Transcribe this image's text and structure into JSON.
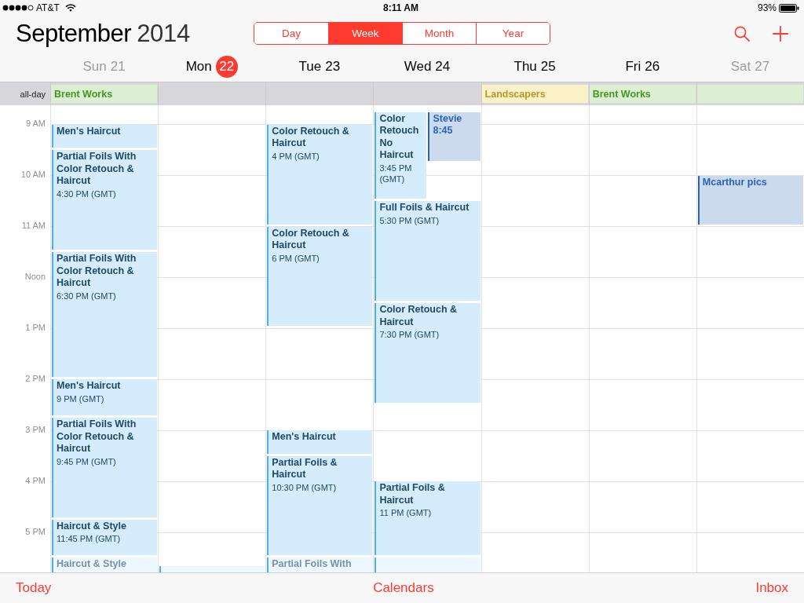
{
  "status_bar": {
    "carrier": "AT&T",
    "time": "8:11 AM",
    "battery": "93%"
  },
  "header": {
    "month": "September",
    "year": "2014",
    "views": [
      {
        "label": "Day",
        "selected": false
      },
      {
        "label": "Week",
        "selected": true
      },
      {
        "label": "Month",
        "selected": false
      },
      {
        "label": "Year",
        "selected": false
      }
    ]
  },
  "all_day_label": "all-day",
  "days": [
    {
      "weekday": "Sun",
      "date": "21",
      "weekend": true,
      "today": false,
      "all_day": [
        {
          "title": "Brent Works",
          "color": "#dcefd3"
        }
      ],
      "events": [
        {
          "title": "Men's Haircut",
          "color": "#4aaef0"
        },
        {
          "title": "Partial Foils With Color Retouch & Haircut",
          "time": "4:30 PM (GMT)",
          "color": "#4aaef0"
        },
        {
          "title": "Partial Foils With Color Retouch & Haircut",
          "time": "6:30 PM (GMT)",
          "color": "#4aaef0"
        },
        {
          "title": "Men's Haircut",
          "time": "9 PM (GMT)",
          "color": "#4aaef0"
        },
        {
          "title": "Partial Foils With Color Retouch & Haircut",
          "time": "9:45 PM (GMT)",
          "color": "#4aaef0"
        },
        {
          "title": "Haircut & Style",
          "time": "11:45 PM (GMT)",
          "color": "#4aaef0"
        },
        {
          "title": "Haircut & Style",
          "color": "#4aaef0"
        }
      ]
    },
    {
      "weekday": "Mon",
      "date": "22",
      "weekend": false,
      "today": true,
      "events": [
        {
          "color": "#4aaef0"
        }
      ]
    },
    {
      "weekday": "Tue",
      "date": "23",
      "weekend": false,
      "today": false,
      "events": [
        {
          "title": "Color Retouch & Haircut",
          "time": "4 PM (GMT)",
          "color": "#4aaef0"
        },
        {
          "title": "Color Retouch & Haircut",
          "time": "6 PM (GMT)",
          "color": "#4aaef0"
        },
        {
          "title": "Men's Haircut",
          "color": "#4aaef0"
        },
        {
          "title": "Partial Foils & Haircut",
          "time": "10:30 PM (GMT)",
          "color": "#4aaef0"
        },
        {
          "title": "Partial Foils With",
          "color": "#4aaef0"
        }
      ]
    },
    {
      "weekday": "Wed",
      "date": "24",
      "weekend": false,
      "today": false,
      "events": [
        {
          "title": "Color Retouch No Haircut",
          "time": "3:45 PM (GMT)",
          "color": "#4aaef0"
        },
        {
          "title": "Stevie 8:45",
          "color": "#2a63b5"
        },
        {
          "title": "Full Foils & Haircut",
          "time": "5:30 PM (GMT)",
          "color": "#4aaef0"
        },
        {
          "title": "Color Retouch & Haircut",
          "time": "7:30 PM (GMT)",
          "color": "#4aaef0"
        },
        {
          "title": "Partial Foils & Haircut",
          "time": "11 PM (GMT)",
          "color": "#4aaef0"
        },
        {
          "color": "#4aaef0"
        }
      ]
    },
    {
      "weekday": "Thu",
      "date": "25",
      "weekend": false,
      "today": false,
      "all_day": [
        {
          "title": "Landscapers",
          "color": "#fbf2c8"
        }
      ]
    },
    {
      "weekday": "Fri",
      "date": "26",
      "weekend": false,
      "today": false,
      "all_day": [
        {
          "title": "Brent Works",
          "color": "#dcefd3"
        }
      ]
    },
    {
      "weekday": "Sat",
      "date": "27",
      "weekend": true,
      "today": false,
      "all_day": [
        {
          "color": "#dcefd3"
        }
      ],
      "events": [
        {
          "title": "Mcarthur pics",
          "color": "#2a63b5"
        }
      ]
    }
  ],
  "hours": [
    "9 AM",
    "10 AM",
    "11 AM",
    "Noon",
    "1 PM",
    "2 PM",
    "3 PM",
    "4 PM",
    "5 PM"
  ],
  "toolbar": [
    "Today",
    "Calendars",
    "Inbox"
  ]
}
